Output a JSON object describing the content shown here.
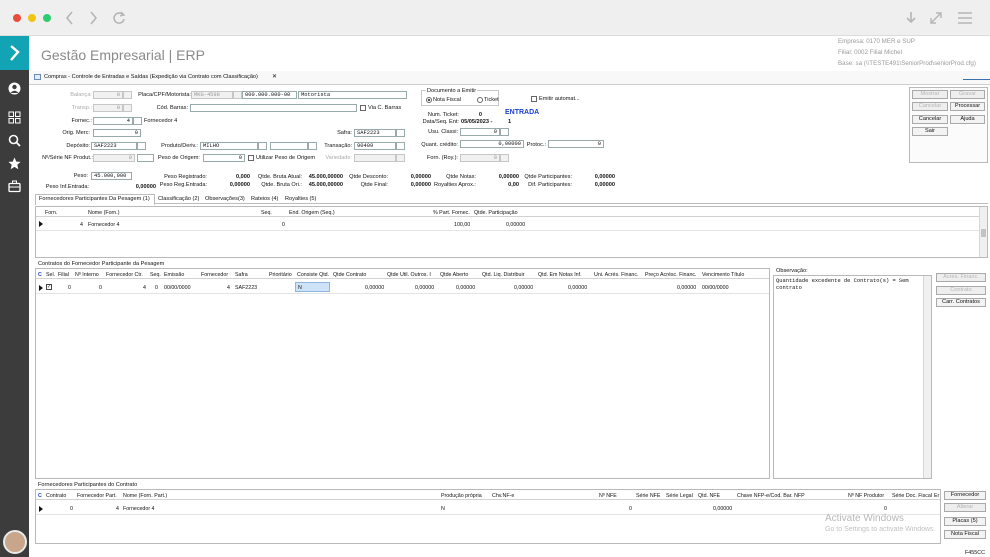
{
  "browser": {
    "icons": [
      "back-icon",
      "forward-icon",
      "refresh-icon",
      "download-icon",
      "expand-icon",
      "menu-icon"
    ]
  },
  "header": {
    "title": "Gestão Empresarial | ERP",
    "empresa": "Empresa: 0170 MER e SUP",
    "filial": "Filial: 0002 Filial Michel",
    "base": "Base: sa (\\\\TESTE491\\SeniorProd\\seniorProd.cfg)"
  },
  "tab": {
    "label": "Compras - Controle de Entradas e Saídas (Expedição via Contrato com Classificação)",
    "close": "✕"
  },
  "form": {
    "balanca_label": "Balança:",
    "balanca": "0",
    "placa_label": "Placa/CPF/Motorista:",
    "placa": "MKG-4598",
    "cpf": "000.000.000-00",
    "motorista": "Motorista",
    "transp_label": "Transp.:",
    "transp": "0",
    "cod_barras_label": "Cód. Barras:",
    "via_barras_label": "Via C. Barras",
    "fornec_label": "Fornec.:",
    "fornec": "4",
    "fornec_nome": "Fornecedor 4",
    "orig_merc_label": "Orig. Merc:",
    "orig_merc": "0",
    "deposito_label": "Depósito:",
    "deposito": "SAF2223",
    "produto_label": "Produto/Deriv.:",
    "produto": "MILHO",
    "nserie_label": "Nº/Série NF Produt.:",
    "nserie": "0",
    "peso_origem_label": "Peso de Origem:",
    "peso_origem": "0",
    "usar_peso_label": "Utilizar Peso de Origem",
    "variedade_label": "Variedade:",
    "safra_label": "Safra:",
    "safra": "SAF2223",
    "transacao_label": "Transação:",
    "transacao": "90409",
    "doc_title": "Documento a Emitir",
    "nota_fiscal": "Nota Fiscal",
    "ticket": "Ticket",
    "emitir_auto": "Emitir automat...",
    "num_ticket_label": "Num. Ticket:",
    "num_ticket": "0",
    "entrada": "ENTRADA",
    "data_seq_label": "Data/Seq. Ent:",
    "data_seq": "05/05/2023 -",
    "seq": "1",
    "usu_class_label": "Usu. Classi:",
    "usu_class": "0",
    "quant_credito_label": "Quant. crédito:",
    "quant_credito": "0,00000",
    "protoc_label": "Protoc.:",
    "protoc": "0",
    "forn_roy_label": "Forn. (Roy.):",
    "forn_roy": "0",
    "peso_label": "Peso:",
    "peso": "45.000,000",
    "peso_inf_label": "Peso Inf.Entrada:",
    "peso_inf": "0,00000",
    "peso_reg_label": "Peso Registrado:",
    "peso_reg": "0,000",
    "peso_reg_ent_label": "Peso Reg.Entrada:",
    "peso_reg_ent": "0,00000",
    "qtde_bruta_atual_label": "Qtde. Bruta Atual:",
    "qtde_bruta_atual": "45.000,00000",
    "qtde_bruta_ori_label": "Qtde. Bruta Ori.:",
    "qtde_bruta_ori": "45.000,00000",
    "qtde_desconto_label": "Qtde Desconto:",
    "qtde_desconto": "0,00000",
    "qtde_final_label": "Qtde Final:",
    "qtde_final": "0,00000",
    "qtde_notas_label": "Qtde Notas:",
    "qtde_notas": "0,00000",
    "royalties_label": "Royalties Aprox.:",
    "royalties": "0,00",
    "qtde_part_label": "Qtde Participantes:",
    "qtde_part": "0,00000",
    "dif_part_label": "Dif. Participantes:",
    "dif_part": "0,00000"
  },
  "buttons": {
    "mostrar": "Mostrar",
    "gravar": "Gravar",
    "cancelar_top": "Cancelar",
    "processar": "Processar",
    "cancelar": "Cancelar",
    "ajuda": "Ajuda",
    "sair": "Sair"
  },
  "subtabs": [
    "Fornecedores Participantes Da Pesagem (1)",
    "Classificação (2)",
    "Observações(3)",
    "Rateios (4)",
    "Royalties (5)"
  ],
  "grid1": {
    "headers": [
      "Forn.",
      "Nome (Forn.)",
      "Seq.",
      "End. Origem (Seq.)",
      "% Part. Fornec.",
      "Qtde. Participação"
    ],
    "row": [
      "4",
      "Fornecedor 4",
      "0",
      "",
      "100,00",
      "0,00000"
    ]
  },
  "contracts": {
    "title": "Contratos do Fornecedor Participante da Pesagem",
    "headers": [
      "C",
      "Sel.",
      "Filial",
      "Nº Interno",
      "Fornecedor Ctr.",
      "Seq.",
      "Emissão",
      "Fornecedor",
      "Safra",
      "Prioritário",
      "Consiste Qtd.",
      "Qtde Contrato",
      "Qtde Util. Outros. I",
      "Qtde Aberto",
      "Qtd. Liq. Distribuir",
      "Qtd. Em Notas Inf.",
      "Uni. Acrés. Financ.",
      "Preço Acrésc. Financ.",
      "Vencimento Título"
    ],
    "row": [
      "0",
      "0",
      "4",
      "0",
      "00/00/0000",
      "4",
      "SAF2223",
      "",
      "N",
      "0,00000",
      "0,00000",
      "0,00000",
      "0,00000",
      "0,00000",
      "0,00000",
      "00/00/0000"
    ],
    "obs_label": "Observação:",
    "obs_text": "Quantidade excedente de Contrato(s) = Sem contrato",
    "btn_acres": "Acres. Financ.",
    "btn_contrato": "Contrato",
    "btn_carr": "Carr. Contratos"
  },
  "bottom": {
    "title": "Fornecedores Participantes do Contrato",
    "headers": [
      "C",
      "Contrato",
      "Fornecedor Part.",
      "Nome (Forn. Part.)",
      "Produção própria",
      "Chv.NF-e",
      "Nº NFE",
      "Série NFE",
      "Série Legal",
      "Qtd. NFE",
      "Chave NFP-e/Cod. Bar. NFP",
      "Nº NF Produtor",
      "Série Doc. Fiscal",
      "Er"
    ],
    "row": [
      "0",
      "4",
      "Fornecedor 4",
      "N",
      "0",
      "0,00000",
      "0"
    ],
    "btn_fornecedor": "Fornecedor",
    "btn_alterar": "Alterar",
    "btn_placas": "Placas (5)",
    "btn_nota": "Nota Fiscal"
  },
  "watermark": {
    "title": "Activate Windows",
    "sub": "Go to Settings to activate Windows."
  },
  "status": "F455CC"
}
